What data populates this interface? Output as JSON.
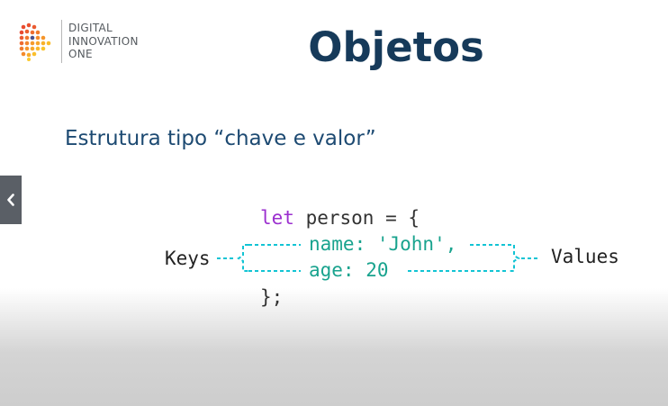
{
  "logo": {
    "line1": "DIGITAL",
    "line2": "INNOVATION",
    "line3": "ONE"
  },
  "slide": {
    "title": "Objetos",
    "subtitle": "Estrutura tipo “chave e valor”"
  },
  "code": {
    "line1_keyword": "let",
    "line1_rest": " person = {",
    "line2": "name: 'John',",
    "line3": "age: 20",
    "line4": "};"
  },
  "annotations": {
    "keys_label": "Keys",
    "values_label": "Values"
  },
  "colors": {
    "title": "#163a5a",
    "subtitle": "#1d4a72",
    "keyword": "#9b2fcf",
    "property": "#19a38e",
    "bracket": "#12c4d4"
  },
  "icons": {
    "nav_prev": "chevron-left-icon"
  }
}
